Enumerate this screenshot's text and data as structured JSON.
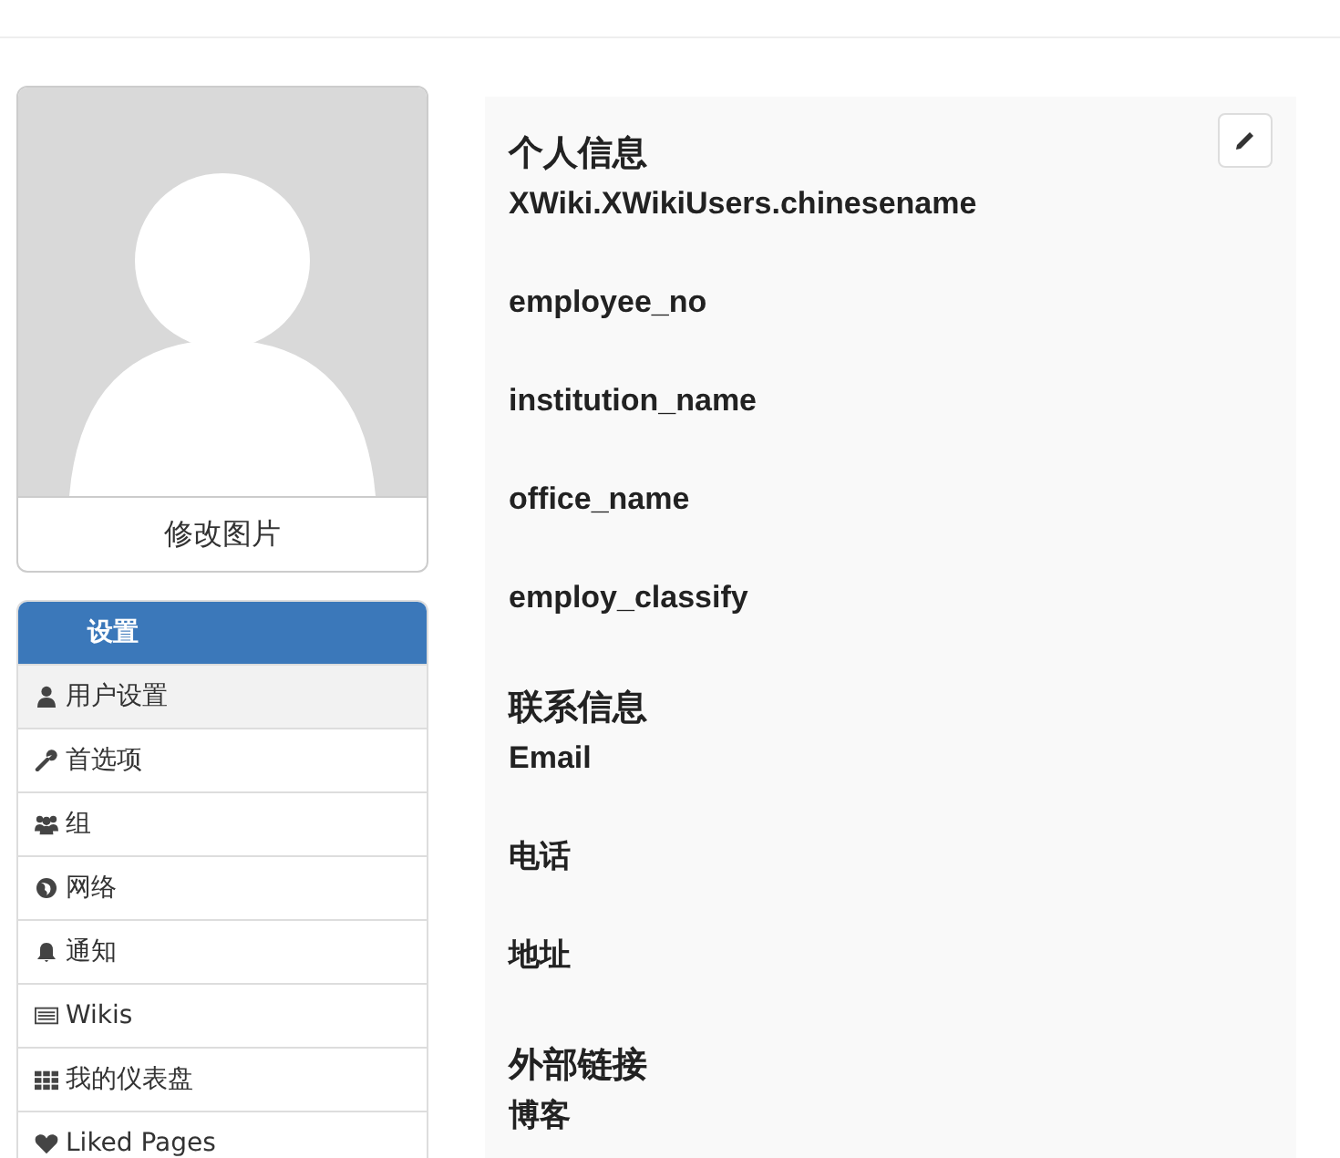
{
  "avatar": {
    "caption": "修改图片"
  },
  "menu": {
    "title": "设置",
    "items": [
      {
        "label": "用户设置",
        "selected": true
      },
      {
        "label": "首选项",
        "selected": false
      },
      {
        "label": "组",
        "selected": false
      },
      {
        "label": "网络",
        "selected": false
      },
      {
        "label": "通知",
        "selected": false
      },
      {
        "label": "Wikis",
        "selected": false
      },
      {
        "label": "我的仪表盘",
        "selected": false
      },
      {
        "label": "Liked Pages",
        "selected": false
      }
    ]
  },
  "sections": [
    {
      "title": "个人信息",
      "fields": [
        "XWiki.XWikiUsers.chinesename",
        "employee_no",
        "institution_name",
        "office_name",
        "employ_classify"
      ]
    },
    {
      "title": "联系信息",
      "fields": [
        "Email",
        "电话",
        "地址"
      ]
    },
    {
      "title": "外部链接",
      "fields": [
        "博客"
      ]
    }
  ]
}
